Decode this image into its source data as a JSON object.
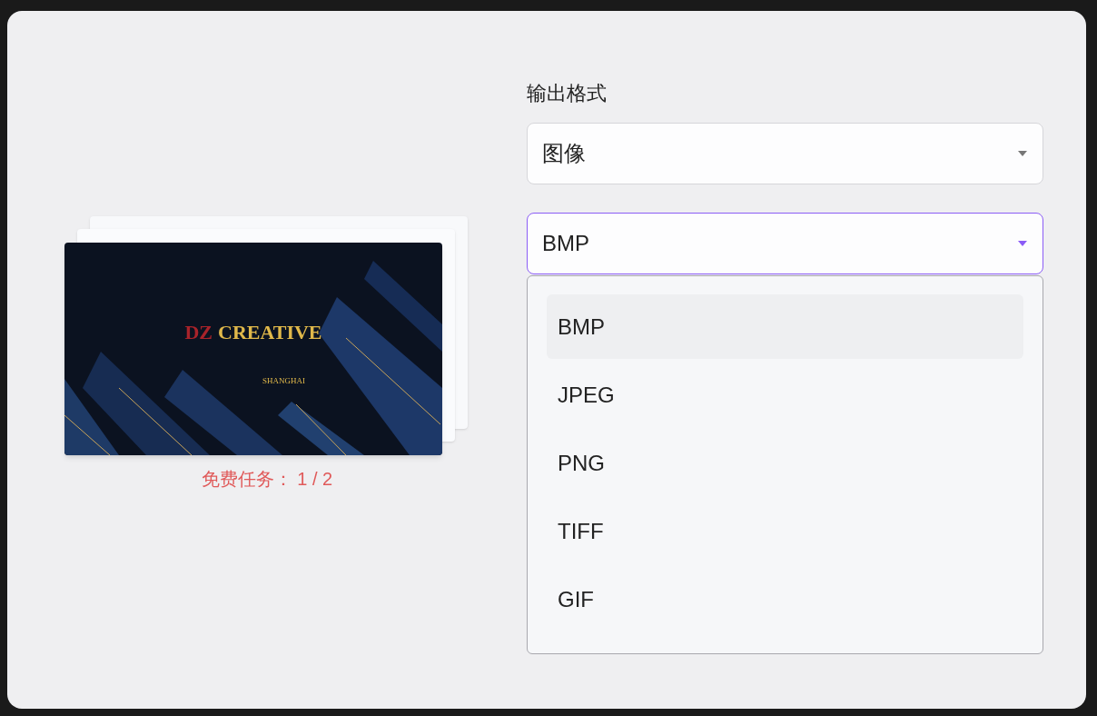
{
  "preview": {
    "slide_title_prefix": "DZ",
    "slide_title": "CREATIVE",
    "slide_subtitle": "SHANGHAI",
    "caption": "免费任务： 1 / 2"
  },
  "output_format": {
    "label": "输出格式",
    "category_select": {
      "value": "图像",
      "expanded": false
    },
    "format_select": {
      "value": "BMP",
      "expanded": true,
      "options": [
        {
          "label": "BMP",
          "selected": true
        },
        {
          "label": "JPEG",
          "selected": false
        },
        {
          "label": "PNG",
          "selected": false
        },
        {
          "label": "TIFF",
          "selected": false
        },
        {
          "label": "GIF",
          "selected": false
        }
      ]
    }
  }
}
